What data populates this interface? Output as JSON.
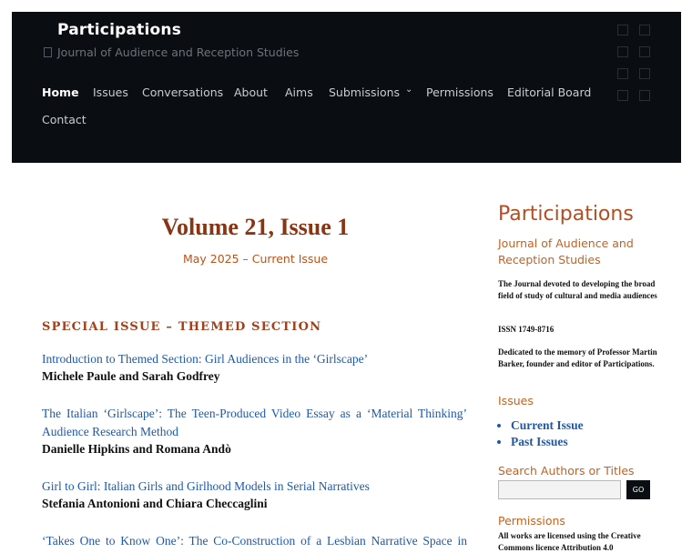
{
  "site": {
    "title": "Participations",
    "tagline": "Journal of Audience and Reception Studies"
  },
  "nav": {
    "items": [
      "Home",
      "Issues",
      "Conversations",
      "About",
      "Aims",
      "Submissions",
      "Permissions",
      "Editorial Board",
      "Contact"
    ]
  },
  "issue": {
    "title": "Volume 21, Issue 1",
    "subtitle": "May 2025 – Current Issue",
    "section": "SPECIAL ISSUE – THEMED SECTION",
    "articles": [
      {
        "title": "Introduction to Themed Section: Girl Audiences in the ‘Girlscape’",
        "authors": "Michele Paule and Sarah Godfrey"
      },
      {
        "title": "The Italian ‘Girlscape’: The Teen-Produced Video Essay as a ‘Material Thinking’ Audience Research Method",
        "authors": "Danielle Hipkins and Romana Andò"
      },
      {
        "title": "Girl to Girl: Italian Girls and Girlhood Models in Serial Narratives",
        "authors": "Stefania Antonioni and Chiara Checcaglini"
      },
      {
        "title": "‘Takes One to Know One’: The Co-Construction of a Lesbian Narrative Space in",
        "authors": ""
      }
    ]
  },
  "sidebar": {
    "title": "Participations",
    "subtitle": "Journal of Audience and Reception Studies",
    "desc": "The Journal devoted to developing the broad field of study of cultural and media audiences",
    "issn": "ISSN 1749-8716",
    "dedication": "Dedicated to the memory of Professor Martin Barker, founder and editor of Participations.",
    "issues_heading": "Issues",
    "issue_links": [
      "Current Issue",
      "Past Issues"
    ],
    "search_heading": "Search Authors or Titles",
    "search_value": "",
    "go_label": "GO",
    "permissions_heading": "Permissions",
    "permissions_text": "All works are licensed using the Creative Commons licence Attribution 4.0"
  }
}
